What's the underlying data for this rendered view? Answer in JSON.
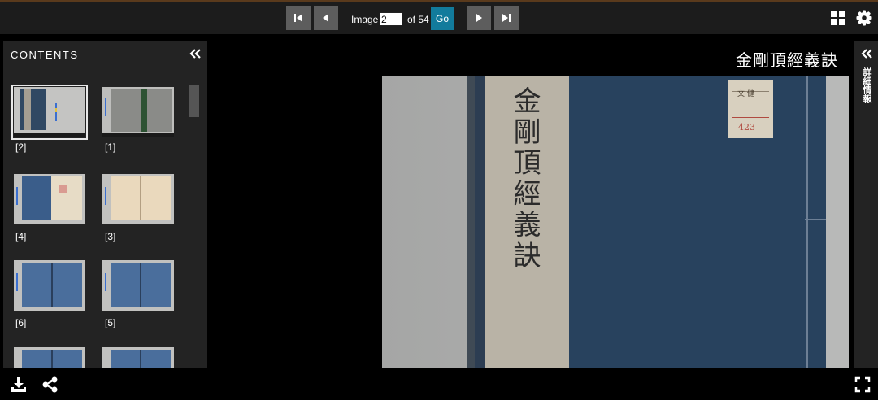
{
  "nav": {
    "image_label": "Image",
    "current_page": "2",
    "of_label": "of 54",
    "go_label": "Go"
  },
  "sidebar": {
    "title": "CONTENTS",
    "thumbnails": [
      {
        "label": "[2]",
        "selected": true
      },
      {
        "label": "[1]",
        "selected": false
      },
      {
        "label": "[4]",
        "selected": false
      },
      {
        "label": "[3]",
        "selected": false
      },
      {
        "label": "[6]",
        "selected": false
      },
      {
        "label": "[5]",
        "selected": false
      },
      {
        "label": "",
        "selected": false
      },
      {
        "label": "",
        "selected": false
      }
    ]
  },
  "document": {
    "title": "金剛頂經義訣",
    "spine_text": "金剛頂經義訣",
    "label_tag": "文 健",
    "label_number": "423"
  },
  "right_panel": {
    "label": "詳細情報"
  },
  "icons": {
    "first": "first-page-icon",
    "prev": "prev-page-icon",
    "next": "next-page-icon",
    "last": "last-page-icon",
    "grid": "grid-view-icon",
    "settings": "gear-icon",
    "collapse_left": "double-chevron-left-icon",
    "collapse_right": "double-chevron-left-icon",
    "download": "download-icon",
    "share": "share-icon",
    "fullscreen": "fullscreen-icon"
  },
  "colors": {
    "go_button": "#127b9c",
    "nav_button": "#5d5d5d",
    "panel": "#232323",
    "cover_blue": "#28425e"
  }
}
